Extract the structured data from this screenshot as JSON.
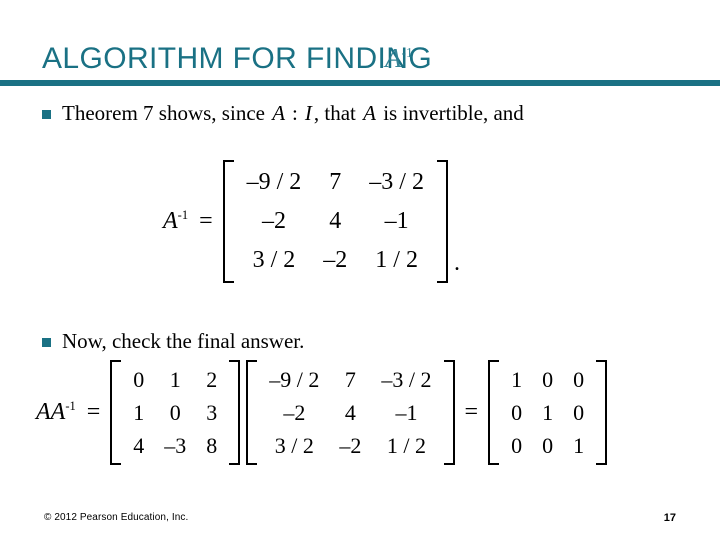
{
  "theme": {
    "accent_color": "#1a7184",
    "text_color": "#000000",
    "background": "#ffffff"
  },
  "title": {
    "text": "ALGORITHM FOR FINDING",
    "overlay_symbol": "A",
    "overlay_superscript": "-1"
  },
  "bullets": [
    {
      "lead": "Theorem 7 shows, since ",
      "var_a": "A",
      "relation": ":",
      "var_i": "I",
      "middle": ", that ",
      "var_a2": "A",
      "tail": " is invertible, and"
    },
    {
      "text": "Now, check the final answer."
    }
  ],
  "equations": {
    "inverse": {
      "label": "A",
      "label_sup": "-1",
      "operator": "=",
      "matrix": [
        [
          "–9 / 2",
          "7",
          "–3 / 2"
        ],
        [
          "–2",
          "4",
          "–1"
        ],
        [
          "3 / 2",
          "–2",
          "1 / 2"
        ]
      ],
      "terminator": "."
    },
    "check": {
      "label": "AA",
      "label_sup": "-1",
      "operator": "=",
      "matrix_a": [
        [
          "0",
          "1",
          "2"
        ],
        [
          "1",
          "0",
          "3"
        ],
        [
          "4",
          "–3",
          "8"
        ]
      ],
      "matrix_b": [
        [
          "–9 / 2",
          "7",
          "–3 / 2"
        ],
        [
          "–2",
          "4",
          "–1"
        ],
        [
          "3 / 2",
          "–2",
          "1 / 2"
        ]
      ],
      "operator2": "=",
      "matrix_result": [
        [
          "1",
          "0",
          "0"
        ],
        [
          "0",
          "1",
          "0"
        ],
        [
          "0",
          "0",
          "1"
        ]
      ]
    }
  },
  "footer": {
    "copyright": "© 2012 Pearson Education, Inc.",
    "page_number": "17"
  }
}
